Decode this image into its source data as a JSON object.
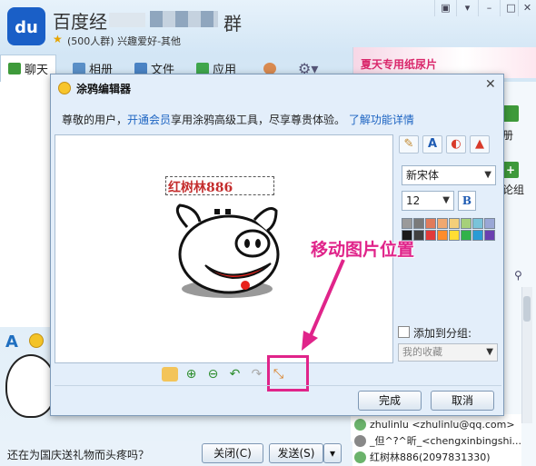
{
  "window": {
    "title_prefix": "百度经",
    "title_suffix": "群",
    "subtitle": "(500人群) 兴趣爱好-其他",
    "logo": "du"
  },
  "tabs": [
    {
      "label": "聊天",
      "icon": "chat-icon"
    },
    {
      "label": "相册",
      "icon": "album-icon"
    },
    {
      "label": "文件",
      "icon": "folder-icon"
    },
    {
      "label": "应用",
      "icon": "apps-icon"
    }
  ],
  "ad": {
    "text": "夏天专用纸尿片"
  },
  "right_panel": {
    "label1": "册",
    "label2": "论组",
    "search_icon": "search-icon"
  },
  "members": [
    "zhulinlu <zhulinlu@qq.com>",
    "_但^?^昕_<chengxinbingshi...",
    "红树林886(2097831330)"
  ],
  "bottom": {
    "status": "还在为国庆送礼物而头疼吗？",
    "close_label": "关闭(C)",
    "send_label": "发送(S)",
    "send_dropdown": "▾"
  },
  "dialog": {
    "title": "涂鸦编辑器",
    "close": "✕",
    "notice_pre": "尊敬的用户，",
    "notice_link": "开通会员",
    "notice_mid": "享用涂鸦高级工具，尽享尊贵体验。",
    "notice_link2": "了解功能详情",
    "text_box": "红树林886",
    "annotation": "移动图片位置",
    "font": "新宋体",
    "size": "12",
    "bold": "B",
    "add_group_label": "添加到分组:",
    "group_select": "我的收藏",
    "ok": "完成",
    "cancel": "取消",
    "palette": [
      "#9a9a9a",
      "#7a7a7a",
      "#e07b5b",
      "#f0a870",
      "#f4cf7a",
      "#a6d07a",
      "#7ac3d9",
      "#9aa7d6",
      "#1a1a1a",
      "#404040",
      "#e23a3a",
      "#ff8c2a",
      "#ffdd33",
      "#31b24a",
      "#2b9bd5",
      "#6a3fb0"
    ]
  }
}
